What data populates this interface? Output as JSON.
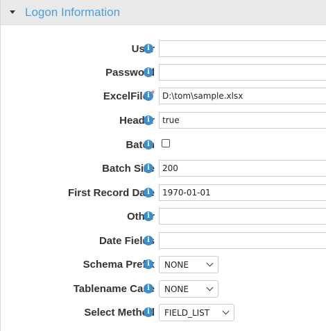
{
  "panel": {
    "title": "Logon Information"
  },
  "fields": {
    "user": {
      "label": "User",
      "value": ""
    },
    "password": {
      "label": "Password",
      "value": ""
    },
    "excelfile": {
      "label": "ExcelFile",
      "required_mark": "*",
      "value": "D:\\tom\\sample.xlsx"
    },
    "header": {
      "label": "Header",
      "value": "true"
    },
    "batch": {
      "label": "Batch",
      "checked": false
    },
    "batch_size": {
      "label": "Batch Size",
      "value": "200"
    },
    "first_record_date": {
      "label": "First Record Date",
      "value": "1970-01-01"
    },
    "other": {
      "label": "Other",
      "value": ""
    },
    "date_fields": {
      "label": "Date Fields",
      "value": ""
    },
    "schema_prefix": {
      "label": "Schema Prefix",
      "value": "NONE"
    },
    "tablename_case": {
      "label": "Tablename Case",
      "value": "NONE"
    },
    "select_method": {
      "label": "Select Method",
      "value": "FIELD_LIST"
    }
  },
  "icons": {
    "info_glyph": "i",
    "info_color": "#3b8fd0",
    "title_color": "#4a9fd8",
    "required_color": "#d9262a"
  }
}
